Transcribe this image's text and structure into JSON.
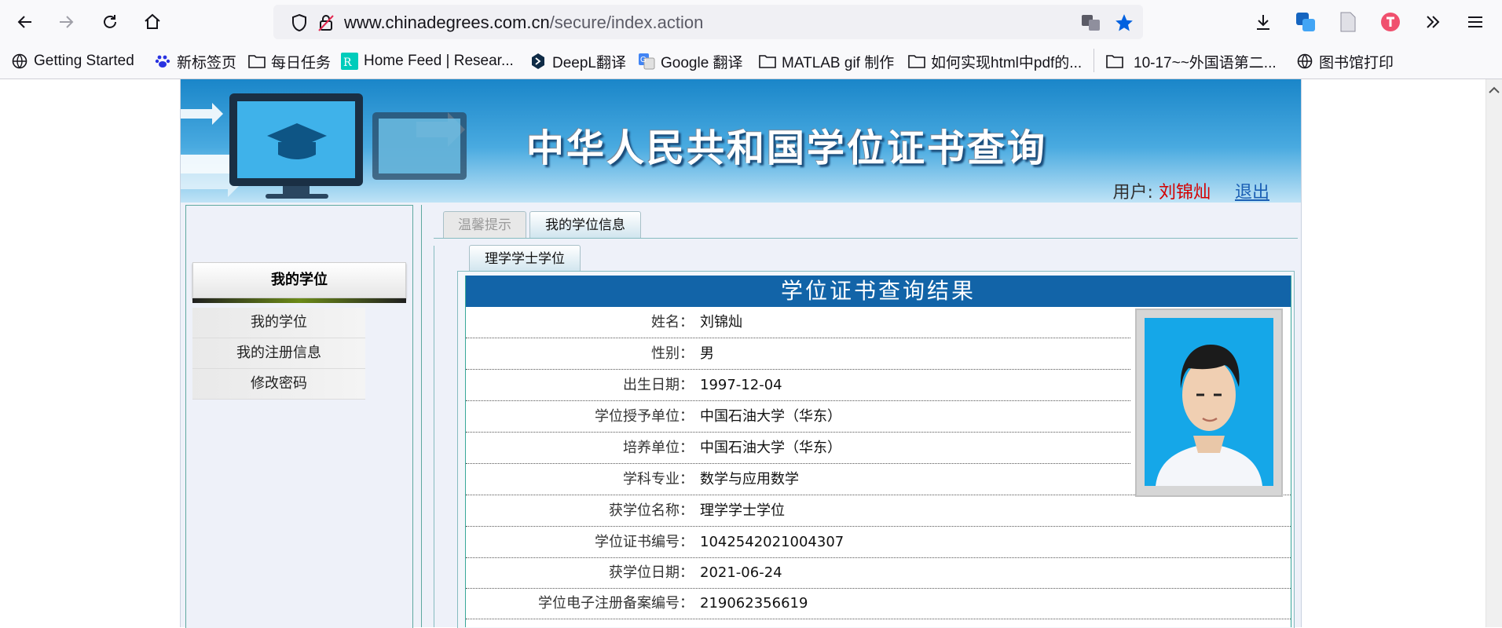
{
  "browser": {
    "url_domain": "www.chinadegrees.com.cn",
    "url_path": "/secure/index.action",
    "bookmarks": [
      {
        "label": "Getting Started",
        "icon": "globe-icon"
      },
      {
        "label": "新标签页",
        "icon": "baidu-icon"
      },
      {
        "label": "每日任务",
        "icon": "folder-icon"
      },
      {
        "label": "Home Feed | Resear...",
        "icon": "researchgate-icon"
      },
      {
        "label": "DeepL翻译",
        "icon": "deepl-icon"
      },
      {
        "label": "Google 翻译",
        "icon": "google-translate-icon"
      },
      {
        "label": "MATLAB gif 制作",
        "icon": "folder-icon"
      },
      {
        "label": "如何实现html中pdf的...",
        "icon": "folder-icon"
      },
      {
        "label": "10-17~~外国语第二...",
        "icon": "folder-icon"
      },
      {
        "label": "图书馆打印",
        "icon": "globe-icon"
      }
    ]
  },
  "site": {
    "banner_title": "中华人民共和国学位证书查询",
    "user_label": "用户:",
    "user_name": "刘锦灿",
    "logout": "退出"
  },
  "sidebar": {
    "heading": "我的学位",
    "items": [
      "我的学位",
      "我的注册信息",
      "修改密码"
    ]
  },
  "tabs": {
    "hint": "温馨提示",
    "mine": "我的学位信息",
    "sub": "理学学士学位"
  },
  "result": {
    "title": "学位证书查询结果",
    "rows": [
      {
        "label": "姓名：",
        "value": "刘锦灿"
      },
      {
        "label": "性别：",
        "value": "男"
      },
      {
        "label": "出生日期：",
        "value": "1997-12-04"
      },
      {
        "label": "学位授予单位：",
        "value": "中国石油大学（华东）"
      },
      {
        "label": "培养单位：",
        "value": "中国石油大学（华东）"
      },
      {
        "label": "学科专业：",
        "value": "数学与应用数学"
      },
      {
        "label": "获学位名称：",
        "value": "理学学士学位"
      },
      {
        "label": "学位证书编号：",
        "value": "1042542021004307"
      },
      {
        "label": "获学位日期：",
        "value": "2021-06-24"
      },
      {
        "label": "学位电子注册备案编号：",
        "value": "219062356619"
      }
    ]
  },
  "colors": {
    "accent_blue": "#1264a8",
    "user_red": "#d40000",
    "link_blue": "#1a5fb4",
    "photo_bg": "#15a7e8"
  }
}
